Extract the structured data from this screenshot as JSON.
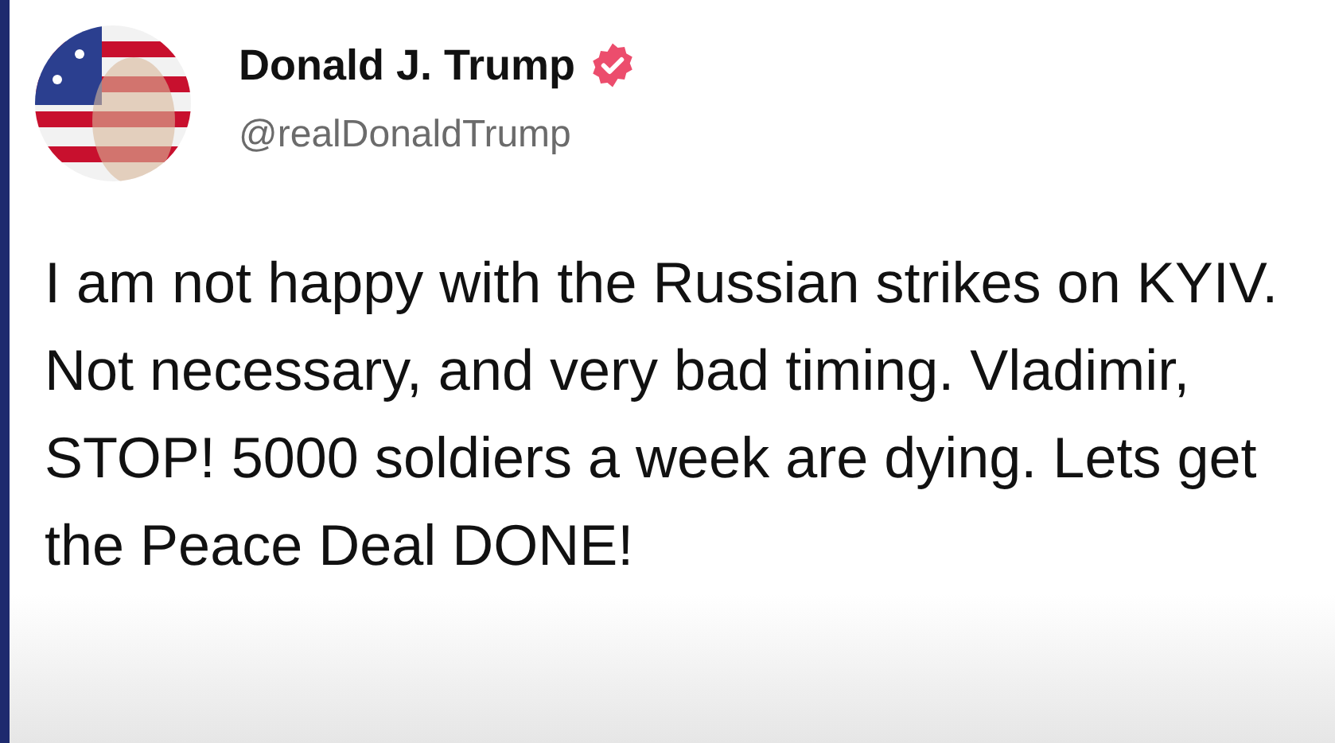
{
  "post": {
    "author": {
      "name": "Donald J. Trump",
      "verified": true,
      "handle": "@realDonaldTrump"
    },
    "text": "I am not happy with the Russian strikes on KYIV. Not necessary, and very bad timing. Vladimir, STOP! 5000 soldiers a week are dying. Lets get the Peace Deal DONE!"
  }
}
